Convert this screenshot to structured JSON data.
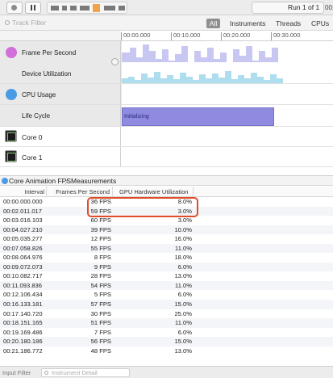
{
  "toolbar": {
    "run_label": "Run 1 of 1",
    "run_extra": "00:0"
  },
  "filter": {
    "placeholder": "Track Filter",
    "segments": [
      "All",
      "Instruments",
      "Threads",
      "CPUs"
    ]
  },
  "ruler": {
    "ticks": [
      "00:00.000",
      "00:10.000",
      "00:20.000",
      "00:30.000"
    ]
  },
  "tracks": [
    {
      "name": "Frame Per Second",
      "icon": "fps-gauge-icon",
      "color": "#d36fd8"
    },
    {
      "name": "Device Utilization",
      "icon": "",
      "color": ""
    },
    {
      "name": "CPU Usage",
      "icon": "cpu-gauge-icon",
      "color": "#4a9be6"
    },
    {
      "name": "Life Cycle",
      "icon": "",
      "color": ""
    },
    {
      "name": "Core 0",
      "icon": "core-chip-icon",
      "color": ""
    },
    {
      "name": "Core 1",
      "icon": "core-chip-icon",
      "color": ""
    }
  ],
  "lifecycle_label": "Initializing",
  "colors": {
    "fps_plot": "#c8c7f1",
    "device_util_plot": "#aeddee",
    "lifecycle_bar": "#8e8be0",
    "highlight": "#e14b2b"
  },
  "detail": {
    "title": "Core Animation FPS",
    "separator": "〉",
    "view": "Measurements"
  },
  "table": {
    "columns": [
      "Interval",
      "Frames Per Second",
      "GPU Hardware Utilization"
    ],
    "rows": [
      [
        "00:00.000.000",
        "36 FPS",
        "8.0%"
      ],
      [
        "00:02.011.017",
        "59 FPS",
        "3.0%"
      ],
      [
        "00:03.016.103",
        "60 FPS",
        "3.0%"
      ],
      [
        "00:04.027.210",
        "39 FPS",
        "10.0%"
      ],
      [
        "00:05.035.277",
        "12 FPS",
        "16.0%"
      ],
      [
        "00:07.058.826",
        "55 FPS",
        "11.0%"
      ],
      [
        "00:08.064.976",
        "8 FPS",
        "18.0%"
      ],
      [
        "00:09.072.073",
        "9 FPS",
        "6.0%"
      ],
      [
        "00:10.082.717",
        "28 FPS",
        "13.0%"
      ],
      [
        "00:11.093.836",
        "54 FPS",
        "11.0%"
      ],
      [
        "00:12.106.434",
        "5 FPS",
        "6.0%"
      ],
      [
        "00:16.133.181",
        "57 FPS",
        "15.0%"
      ],
      [
        "00:17.140.720",
        "30 FPS",
        "25.0%"
      ],
      [
        "00:18.151.165",
        "51 FPS",
        "11.0%"
      ],
      [
        "00:19.169.486",
        "7 FPS",
        "6.0%"
      ],
      [
        "00:20.180.186",
        "56 FPS",
        "15.0%"
      ],
      [
        "00:21.186.772",
        "48 FPS",
        "13.0%"
      ]
    ]
  },
  "bottom": {
    "input_filter": "Input Filter",
    "detail_placeholder": "Instrument Detail"
  }
}
